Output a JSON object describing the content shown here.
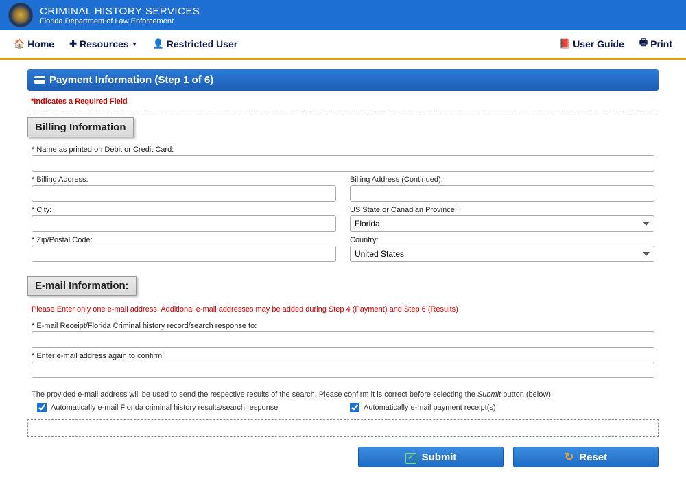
{
  "header": {
    "title": "CRIMINAL HISTORY SERVICES",
    "subtitle": "Florida Department of Law Enforcement"
  },
  "nav": {
    "left": [
      {
        "icon": "🏠",
        "label": "Home"
      },
      {
        "icon": "✚",
        "label": "Resources",
        "has_caret": true
      },
      {
        "icon": "👤",
        "label": "Restricted User"
      }
    ],
    "right": [
      {
        "icon": "📕",
        "label": "User Guide"
      },
      {
        "icon": "🖶",
        "label": "Print"
      }
    ]
  },
  "step": {
    "title": "Payment Information (Step 1 of 6)"
  },
  "required_note": "*Indicates a Required Field",
  "billing": {
    "section_title": "Billing Information",
    "name_label": "* Name as printed on Debit or Credit Card:",
    "name_value": "",
    "address_label": "* Billing Address:",
    "address_value": "",
    "address_cont_label": "Billing Address (Continued):",
    "address_cont_value": "",
    "city_label": "* City:",
    "city_value": "",
    "state_label": "US State or Canadian Province:",
    "state_value": "Florida",
    "zip_label": "* Zip/Postal Code:",
    "zip_value": "",
    "country_label": "Country:",
    "country_value": "United States"
  },
  "email": {
    "section_title": "E-mail Information:",
    "note": "Please Enter only one e-mail address. Additional e-mail addresses may be added during Step 4 (Payment) and Step 6 (Results)",
    "email1_label": "* E-mail Receipt/Florida Criminal history record/search response to:",
    "email1_value": "",
    "email2_label": "* Enter e-mail address again to confirm:",
    "email2_value": "",
    "confirm_text_pre": "The provided e-mail address will be used to send the respective results of the search. Please confirm it is correct before selecting the ",
    "confirm_text_em": "Submit",
    "confirm_text_post": " button (below):",
    "checkbox1_label": "Automatically e-mail Florida criminal history results/search response",
    "checkbox1_checked": true,
    "checkbox2_label": "Automatically e-mail payment receipt(s)",
    "checkbox2_checked": true
  },
  "buttons": {
    "submit": "Submit",
    "reset": "Reset"
  }
}
